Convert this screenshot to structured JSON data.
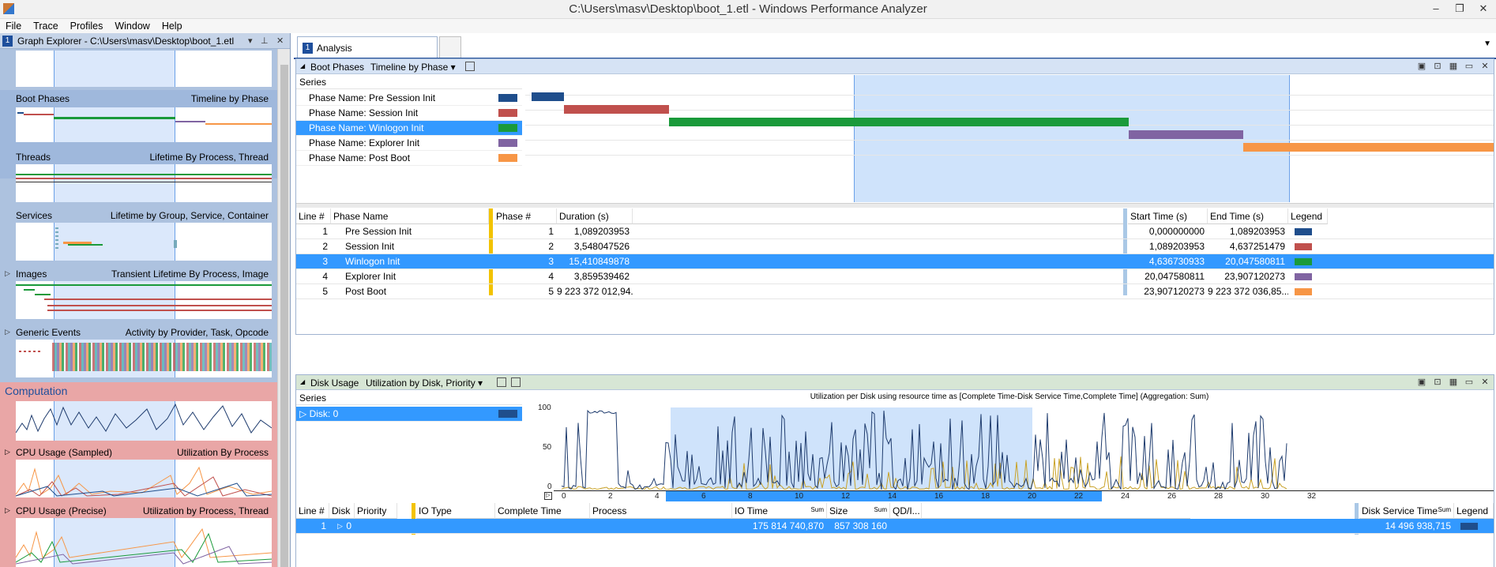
{
  "window": {
    "title": "C:\\Users\\masv\\Desktop\\boot_1.etl - Windows Performance Analyzer",
    "minimize": "–",
    "restore": "❐",
    "close": "✕"
  },
  "menu": [
    "File",
    "Trace",
    "Profiles",
    "Window",
    "Help"
  ],
  "graph_explorer": {
    "number": "1",
    "title": "Graph Explorer - C:\\Users\\masv\\Desktop\\boot_1.etl",
    "close": "✕",
    "sections": [
      {
        "name": "Boot Phases",
        "view": "Timeline by Phase"
      },
      {
        "name": "Threads",
        "view": "Lifetime By Process, Thread"
      },
      {
        "name": "Services",
        "view": "Lifetime by Group, Service, Container"
      },
      {
        "name": "Images",
        "view": "Transient Lifetime By Process, Image"
      },
      {
        "name": "Generic Events",
        "view": "Activity by Provider, Task, Opcode"
      }
    ],
    "computation": {
      "title": "Computation",
      "sections": [
        {
          "name": "CPU Usage (Sampled)",
          "view": "Utilization By Process"
        },
        {
          "name": "CPU Usage (Precise)",
          "view": "Utilization by Process, Thread"
        }
      ]
    }
  },
  "analysis": {
    "tab_number": "1",
    "tab_label": "Analysis",
    "boot_phases": {
      "title": "Boot Phases",
      "view": "Timeline by Phase",
      "series_header": "Series",
      "series": [
        {
          "label": "Phase Name: Pre Session Init",
          "color": "#1f4e8c"
        },
        {
          "label": "Phase Name: Session Init",
          "color": "#c0504d"
        },
        {
          "label": "Phase Name: Winlogon Init",
          "color": "#1a9a3a"
        },
        {
          "label": "Phase Name: Explorer Init",
          "color": "#8064a2"
        },
        {
          "label": "Phase Name: Post Boot",
          "color": "#f79646"
        }
      ],
      "timeline": [
        {
          "start": 0.0,
          "end": 1.089
        },
        {
          "start": 1.089,
          "end": 4.637
        },
        {
          "start": 4.637,
          "end": 20.048
        },
        {
          "start": 20.048,
          "end": 23.907
        },
        {
          "start": 23.907,
          "end": 32.3
        }
      ],
      "columns": [
        "Line #",
        "Phase Name",
        "Phase #",
        "Duration (s)",
        "Start Time (s)",
        "End Time (s)",
        "Legend"
      ],
      "rows": [
        {
          "line": "1",
          "name": "Pre Session Init",
          "phase": "1",
          "duration": "1,089203953",
          "start": "0,000000000",
          "end": "1,089203953",
          "color": "#1f4e8c"
        },
        {
          "line": "2",
          "name": "Session Init",
          "phase": "2",
          "duration": "3,548047526",
          "start": "1,089203953",
          "end": "4,637251479",
          "color": "#c0504d"
        },
        {
          "line": "3",
          "name": "Winlogon Init",
          "phase": "3",
          "duration": "15,410849878",
          "start": "4,636730933",
          "end": "20,047580811",
          "color": "#1a9a3a"
        },
        {
          "line": "4",
          "name": "Explorer Init",
          "phase": "4",
          "duration": "3,859539462",
          "start": "20,047580811",
          "end": "23,907120273",
          "color": "#8064a2"
        },
        {
          "line": "5",
          "name": "Post Boot",
          "phase": "5",
          "duration": "9 223 372 012,94...",
          "start": "23,907120273",
          "end": "9 223 372 036,85...",
          "color": "#f79646"
        }
      ]
    },
    "disk_usage": {
      "title": "Disk Usage",
      "view": "Utilization by Disk, Priority",
      "series_header": "Series",
      "series": [
        {
          "label": "Disk: 0",
          "color": "#1f4e8c"
        }
      ],
      "chart_title": "Utilization per Disk using resource time as [Complete Time-Disk Service Time,Complete Time] (Aggregation: Sum)",
      "y_ticks": [
        "100",
        "50",
        "0"
      ],
      "x_ticks": [
        "0",
        "2",
        "4",
        "6",
        "8",
        "10",
        "12",
        "14",
        "16",
        "18",
        "20",
        "22",
        "24",
        "26",
        "28",
        "30",
        "32"
      ],
      "columns": [
        "Line #",
        "Disk",
        "Priority",
        "IO Type",
        "Complete Time",
        "Process",
        "IO Time",
        "Size",
        "QD/I...",
        "Disk Service Time",
        "Legend"
      ],
      "sum_label": "Sum",
      "rows": [
        {
          "line": "1",
          "disk": "0",
          "io_time": "175 814 740,870",
          "size": "857 308 160",
          "service": "14 496 938,715",
          "color": "#1f4e8c"
        }
      ]
    }
  }
}
